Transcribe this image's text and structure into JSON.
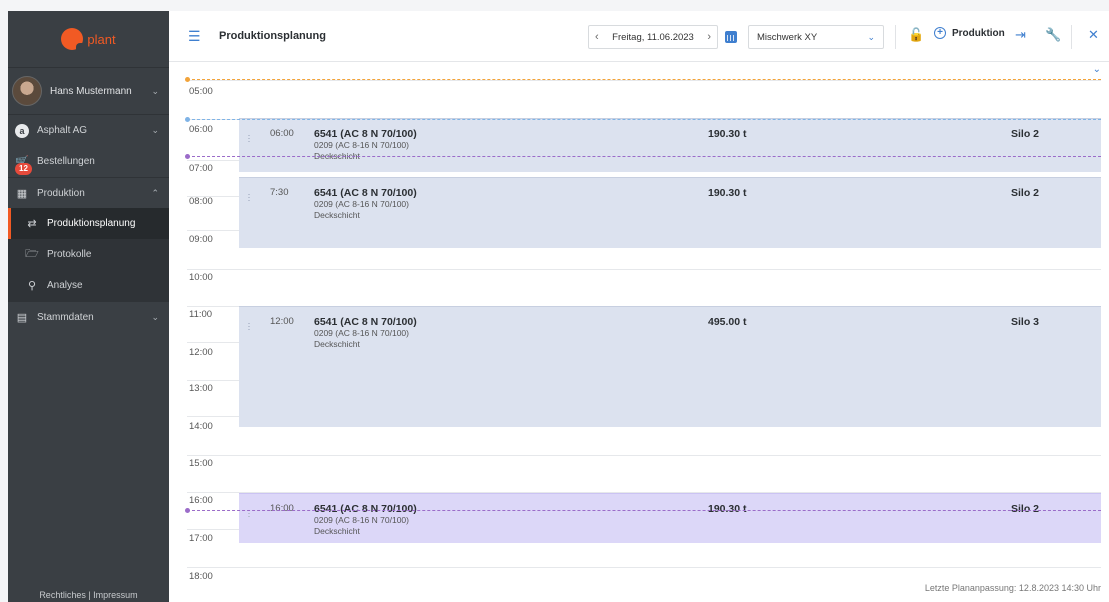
{
  "brand": {
    "logo_text": "plant",
    "color": "#f15a24"
  },
  "user": {
    "name": "Hans Mustermann"
  },
  "sidebar": {
    "company": "Asphalt AG",
    "orders": {
      "label": "Bestellungen",
      "badge": "12"
    },
    "production": {
      "label": "Produktion"
    },
    "sub_items": [
      {
        "label": "Produktionsplanung",
        "icon": "planning-icon",
        "active": true
      },
      {
        "label": "Protokolle",
        "icon": "folder-icon",
        "active": false
      },
      {
        "label": "Analyse",
        "icon": "zoom-icon",
        "active": false
      }
    ],
    "master_data": {
      "label": "Stammdaten"
    },
    "footer": "Rechtliches | Impressum"
  },
  "header": {
    "title": "Produktionsplanung",
    "date": "Freitag, 11.06.2023",
    "plant": "Mischwerk XY",
    "production_button": "Produktion"
  },
  "timeline": {
    "hours": [
      "05:00",
      "06:00",
      "07:00",
      "08:00",
      "09:00",
      "10:00",
      "11:00",
      "12:00",
      "13:00",
      "14:00",
      "15:00",
      "16:00",
      "17:00",
      "18:00"
    ],
    "entries": [
      {
        "time": "06:00",
        "code": "6541 (AC 8 N 70/100)",
        "sub": "0209 (AC 8-16 N 70/100)",
        "layer": "Deckschicht",
        "qty": "190.30 t",
        "silo": "Silo 2"
      },
      {
        "time": "7:30",
        "code": "6541 (AC 8 N 70/100)",
        "sub": "0209 (AC 8-16 N 70/100)",
        "layer": "Deckschicht",
        "qty": "190.30 t",
        "silo": "Silo 2"
      },
      {
        "time": "12:00",
        "code": "6541 (AC 8 N 70/100)",
        "sub": "0209 (AC 8-16 N 70/100)",
        "layer": "Deckschicht",
        "qty": "495.00 t",
        "silo": "Silo 3"
      },
      {
        "time": "16:00",
        "code": "6541 (AC 8 N 70/100)",
        "sub": "0209 (AC 8-16 N 70/100)",
        "layer": "Deckschicht",
        "qty": "190.30 t",
        "silo": "Silo 2"
      }
    ],
    "last_update": "Letzte Plananpassung: 12.8.2023 14:30 Uhr"
  },
  "colors": {
    "accent": "#3f7fcf",
    "orange_line": "#f2a33a",
    "blue_line": "#7fb3e6",
    "purple_line": "#9b6cc9"
  }
}
